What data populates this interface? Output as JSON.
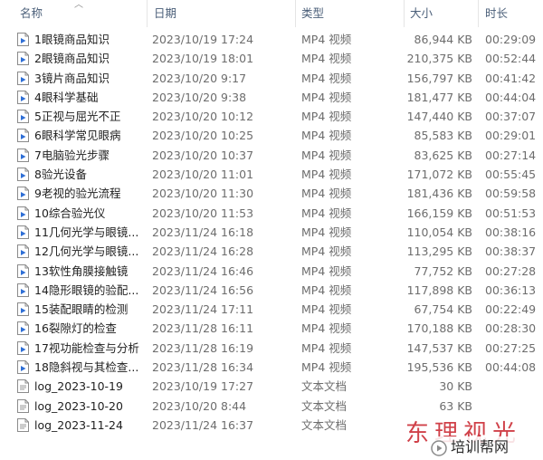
{
  "columns": {
    "name": "名称",
    "date": "日期",
    "type": "类型",
    "size": "大小",
    "duration": "时长"
  },
  "files": [
    {
      "icon": "video-file-icon",
      "name": "1眼镜商品知识",
      "date": "2023/10/19 17:24",
      "type": "MP4 视频",
      "size": "86,944 KB",
      "duration": "00:29:09"
    },
    {
      "icon": "video-file-icon",
      "name": "2眼镜商品知识",
      "date": "2023/10/19 18:01",
      "type": "MP4 视频",
      "size": "210,375 KB",
      "duration": "00:52:44"
    },
    {
      "icon": "video-file-icon",
      "name": "3镜片商品知识",
      "date": "2023/10/20 9:17",
      "type": "MP4 视频",
      "size": "156,797 KB",
      "duration": "00:41:42"
    },
    {
      "icon": "video-file-icon",
      "name": "4眼科学基础",
      "date": "2023/10/20 9:38",
      "type": "MP4 视频",
      "size": "181,477 KB",
      "duration": "00:44:04"
    },
    {
      "icon": "video-file-icon",
      "name": "5正视与屈光不正",
      "date": "2023/10/20 10:12",
      "type": "MP4 视频",
      "size": "147,440 KB",
      "duration": "00:37:07"
    },
    {
      "icon": "video-file-icon",
      "name": "6眼科学常见眼病",
      "date": "2023/10/20 10:25",
      "type": "MP4 视频",
      "size": "85,583 KB",
      "duration": "00:29:01"
    },
    {
      "icon": "video-file-icon",
      "name": "7电脑验光步骤",
      "date": "2023/10/20 10:37",
      "type": "MP4 视频",
      "size": "83,625 KB",
      "duration": "00:27:14"
    },
    {
      "icon": "video-file-icon",
      "name": "8验光设备",
      "date": "2023/10/20 11:01",
      "type": "MP4 视频",
      "size": "171,072 KB",
      "duration": "00:55:45"
    },
    {
      "icon": "video-file-icon",
      "name": "9老视的验光流程",
      "date": "2023/10/20 11:30",
      "type": "MP4 视频",
      "size": "181,436 KB",
      "duration": "00:59:58"
    },
    {
      "icon": "video-file-icon",
      "name": "10综合验光仪",
      "date": "2023/10/20 11:53",
      "type": "MP4 视频",
      "size": "166,159 KB",
      "duration": "00:51:53"
    },
    {
      "icon": "video-file-icon",
      "name": "11几何光学与眼镜...",
      "date": "2023/11/24 16:18",
      "type": "MP4 视频",
      "size": "110,054 KB",
      "duration": "00:38:16"
    },
    {
      "icon": "video-file-icon",
      "name": "12几何光学与眼镜...",
      "date": "2023/11/24 16:28",
      "type": "MP4 视频",
      "size": "113,295 KB",
      "duration": "00:38:37"
    },
    {
      "icon": "video-file-icon",
      "name": "13软性角膜接触镜",
      "date": "2023/11/24 16:46",
      "type": "MP4 视频",
      "size": "77,752 KB",
      "duration": "00:27:28"
    },
    {
      "icon": "video-file-icon",
      "name": "14隐形眼镜的验配...",
      "date": "2023/11/24 16:56",
      "type": "MP4 视频",
      "size": "117,898 KB",
      "duration": "00:36:13"
    },
    {
      "icon": "video-file-icon",
      "name": "15装配眼睛的检测",
      "date": "2023/11/24 17:11",
      "type": "MP4 视频",
      "size": "67,754 KB",
      "duration": "00:22:49"
    },
    {
      "icon": "video-file-icon",
      "name": "16裂隙灯的检查",
      "date": "2023/11/28 16:11",
      "type": "MP4 视频",
      "size": "170,188 KB",
      "duration": "00:28:30"
    },
    {
      "icon": "video-file-icon",
      "name": "17视功能检查与分析",
      "date": "2023/11/28 16:19",
      "type": "MP4 视频",
      "size": "147,537 KB",
      "duration": "00:27:25"
    },
    {
      "icon": "video-file-icon",
      "name": "18隐斜视与其检查...",
      "date": "2023/11/28 16:34",
      "type": "MP4 视频",
      "size": "195,536 KB",
      "duration": "00:44:08"
    },
    {
      "icon": "text-file-icon",
      "name": "log_2023-10-19",
      "date": "2023/10/19 17:27",
      "type": "文本文档",
      "size": "30 KB",
      "duration": ""
    },
    {
      "icon": "text-file-icon",
      "name": "log_2023-10-20",
      "date": "2023/10/20 8:44",
      "type": "文本文档",
      "size": "63 KB",
      "duration": ""
    },
    {
      "icon": "text-file-icon",
      "name": "log_2023-11-24",
      "date": "2023/11/24 16:37",
      "type": "文本文档",
      "size": "",
      "duration": ""
    }
  ],
  "watermark": {
    "top_text": "东理视光",
    "badge_text": "培训帮网"
  },
  "colors": {
    "header_text": "#4c607a",
    "secondary_text": "#6d6d6d",
    "watermark_red": "#c8202a",
    "video_icon_blue": "#2f6fd6"
  }
}
